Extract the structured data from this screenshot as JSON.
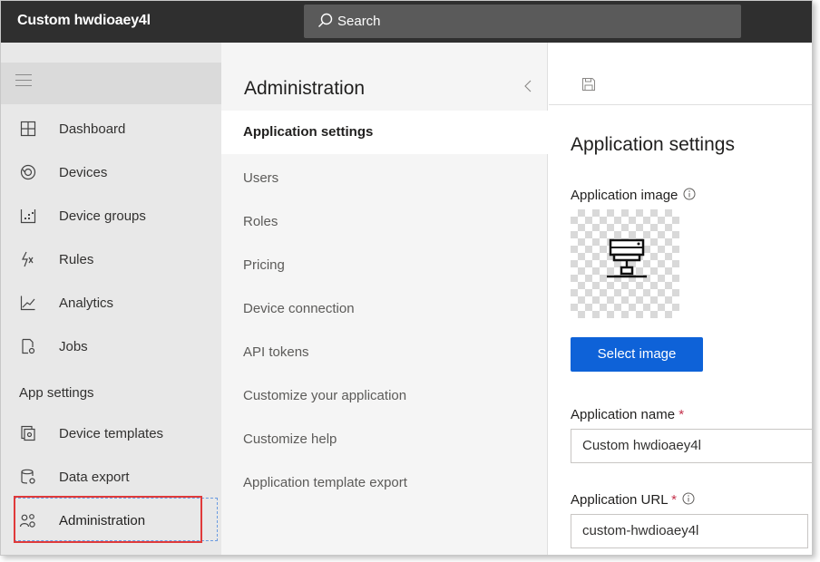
{
  "app": {
    "title": "Custom hwdioaey4l"
  },
  "search": {
    "label": "Search"
  },
  "leftnav": {
    "items": [
      {
        "label": "Dashboard",
        "icon": "dashboard-icon"
      },
      {
        "label": "Devices",
        "icon": "devices-icon"
      },
      {
        "label": "Device groups",
        "icon": "device-groups-icon"
      },
      {
        "label": "Rules",
        "icon": "rules-icon"
      },
      {
        "label": "Analytics",
        "icon": "analytics-icon"
      },
      {
        "label": "Jobs",
        "icon": "jobs-icon"
      }
    ],
    "section_label": "App settings",
    "settings_items": [
      {
        "label": "Device templates",
        "icon": "device-templates-icon"
      },
      {
        "label": "Data export",
        "icon": "data-export-icon"
      },
      {
        "label": "Administration",
        "icon": "administration-icon"
      }
    ]
  },
  "admin_panel": {
    "title": "Administration",
    "items": [
      {
        "label": "Application settings",
        "active": true
      },
      {
        "label": "Users"
      },
      {
        "label": "Roles"
      },
      {
        "label": "Pricing"
      },
      {
        "label": "Device connection"
      },
      {
        "label": "API tokens"
      },
      {
        "label": "Customize your application"
      },
      {
        "label": "Customize help"
      },
      {
        "label": "Application template export"
      }
    ]
  },
  "content": {
    "title": "Application settings",
    "image_label": "Application image",
    "select_image_label": "Select image",
    "name_label": "Application name",
    "name_value": "Custom hwdioaey4l",
    "url_label": "Application URL",
    "url_value": "custom-hwdioaey4l",
    "required_mark": "*"
  },
  "colors": {
    "topbar": "#2f2f2f",
    "accent": "#0e62d8",
    "highlight": "#e03a3a"
  }
}
